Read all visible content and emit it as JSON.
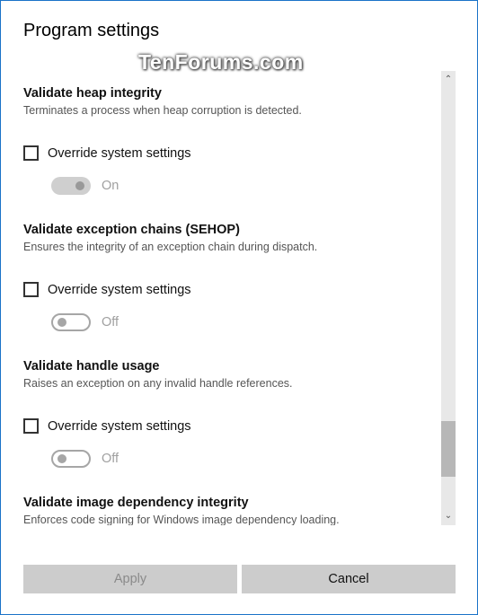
{
  "dialog": {
    "title": "Program settings",
    "watermark": "TenForums.com"
  },
  "sections": [
    {
      "title": "Validate heap integrity",
      "description": "Terminates a process when heap corruption is detected.",
      "override_label": "Override system settings",
      "override_checked": false,
      "toggle_state": "On"
    },
    {
      "title": "Validate exception chains (SEHOP)",
      "description": "Ensures the integrity of an exception chain during dispatch.",
      "override_label": "Override system settings",
      "override_checked": false,
      "toggle_state": "Off"
    },
    {
      "title": "Validate handle usage",
      "description": "Raises an exception on any invalid handle references.",
      "override_label": "Override system settings",
      "override_checked": false,
      "toggle_state": "Off"
    },
    {
      "title": "Validate image dependency integrity",
      "description": "Enforces code signing for Windows image dependency loading."
    }
  ],
  "scrollbar": {
    "up_icon": "chevron-up",
    "down_icon": "chevron-down",
    "position_fraction": 0.8
  },
  "buttons": {
    "apply": "Apply",
    "cancel": "Cancel"
  }
}
